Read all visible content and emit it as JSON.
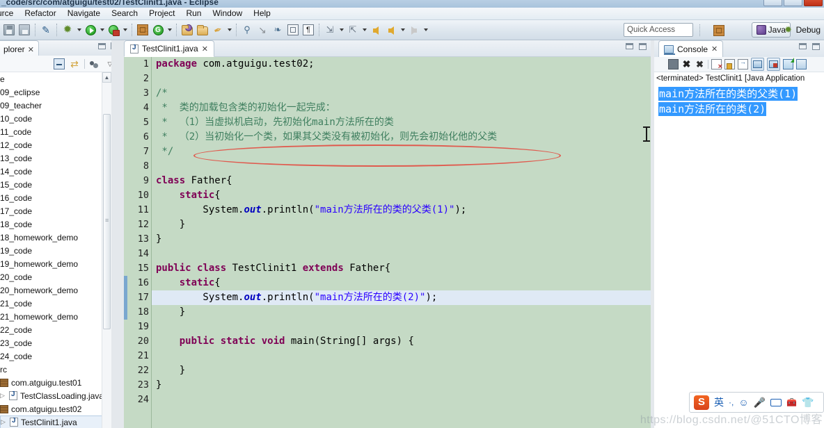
{
  "window": {
    "title": "_code/src/com/atguigu/test02/TestClinit1.java - Eclipse",
    "minimize_label": "",
    "maximize_label": "",
    "close_label": ""
  },
  "menubar": {
    "items": [
      {
        "label": "urce"
      },
      {
        "label": "Refactor"
      },
      {
        "label": "Navigate"
      },
      {
        "label": "Search"
      },
      {
        "label": "Project"
      },
      {
        "label": "Run"
      },
      {
        "label": "Window"
      },
      {
        "label": "Help"
      }
    ]
  },
  "toolbar": {
    "quick_access_placeholder": "Quick Access",
    "perspective_java": "Java",
    "perspective_debug": "Debug",
    "buttons": [
      {
        "name": "save-icon"
      },
      {
        "name": "save-all-icon"
      },
      {
        "name": "link-icon"
      },
      {
        "name": "external-tools-icon"
      },
      {
        "name": "run-icon"
      },
      {
        "name": "debug-icon"
      },
      {
        "name": "new-java-package-icon"
      },
      {
        "name": "open-type-icon"
      },
      {
        "name": "open-resource-icon"
      },
      {
        "name": "open-task-icon"
      },
      {
        "name": "brush-icon"
      },
      {
        "name": "pin-icon"
      },
      {
        "name": "wand-icon"
      },
      {
        "name": "toggle-block-icon"
      },
      {
        "name": "pilcrow-icon"
      },
      {
        "name": "next-annotation-icon"
      },
      {
        "name": "previous-annotation-icon"
      },
      {
        "name": "back-icon"
      },
      {
        "name": "forward-icon"
      }
    ]
  },
  "package_explorer": {
    "tab_label": "plorer",
    "tab_close": "✕",
    "toolbar": {
      "collapse_all": "collapse-all-icon",
      "link_with_editor": "link-with-editor-icon",
      "view_menu": "view-menu-icon"
    },
    "items": [
      {
        "label": "e",
        "type": "folder",
        "indent": 0,
        "expander": ""
      },
      {
        "label": "09_eclipse",
        "type": "folder",
        "indent": 0,
        "expander": ""
      },
      {
        "label": "09_teacher",
        "type": "folder",
        "indent": 0,
        "expander": ""
      },
      {
        "label": "10_code",
        "type": "folder",
        "indent": 0,
        "expander": ""
      },
      {
        "label": "11_code",
        "type": "folder",
        "indent": 0,
        "expander": ""
      },
      {
        "label": "12_code",
        "type": "folder",
        "indent": 0,
        "expander": ""
      },
      {
        "label": "13_code",
        "type": "folder",
        "indent": 0,
        "expander": ""
      },
      {
        "label": "14_code",
        "type": "folder",
        "indent": 0,
        "expander": ""
      },
      {
        "label": "15_code",
        "type": "folder",
        "indent": 0,
        "expander": ""
      },
      {
        "label": "16_code",
        "type": "folder",
        "indent": 0,
        "expander": ""
      },
      {
        "label": "17_code",
        "type": "folder",
        "indent": 0,
        "expander": ""
      },
      {
        "label": "18_code",
        "type": "folder",
        "indent": 0,
        "expander": ""
      },
      {
        "label": "18_homework_demo",
        "type": "folder",
        "indent": 0,
        "expander": ""
      },
      {
        "label": "19_code",
        "type": "folder",
        "indent": 0,
        "expander": ""
      },
      {
        "label": "19_homework_demo",
        "type": "folder",
        "indent": 0,
        "expander": ""
      },
      {
        "label": "20_code",
        "type": "folder",
        "indent": 0,
        "expander": ""
      },
      {
        "label": "20_homework_demo",
        "type": "folder",
        "indent": 0,
        "expander": ""
      },
      {
        "label": "21_code",
        "type": "folder",
        "indent": 0,
        "expander": ""
      },
      {
        "label": "21_homework_demo",
        "type": "folder",
        "indent": 0,
        "expander": ""
      },
      {
        "label": "22_code",
        "type": "folder",
        "indent": 0,
        "expander": ""
      },
      {
        "label": "23_code",
        "type": "folder",
        "indent": 0,
        "expander": ""
      },
      {
        "label": "24_code",
        "type": "folder",
        "indent": 0,
        "expander": ""
      },
      {
        "label": "rc",
        "type": "source-folder",
        "indent": 0,
        "expander": ""
      },
      {
        "label": "com.atguigu.test01",
        "type": "package",
        "indent": 0,
        "expander": ""
      },
      {
        "label": "TestClassLoading.java",
        "type": "java-file",
        "indent": 1,
        "expander": "▷"
      },
      {
        "label": "com.atguigu.test02",
        "type": "package",
        "indent": 0,
        "expander": ""
      },
      {
        "label": "TestClinit1.java",
        "type": "java-file",
        "indent": 1,
        "expander": "▷",
        "selected": true
      }
    ]
  },
  "editor": {
    "tab_label": "TestClinit1.java",
    "tab_close": "✕",
    "lines": [
      {
        "n": "1",
        "fold": "",
        "html": "<span class=\"k\">package</span> com.atguigu.test02;"
      },
      {
        "n": "2",
        "fold": "",
        "html": ""
      },
      {
        "n": "3",
        "fold": "⊖",
        "html": "<span class=\"cmt\">/*</span>"
      },
      {
        "n": "4",
        "fold": "",
        "html": "<span class=\"cmt\"> *  类的加载包含类的初始化一起完成：</span>"
      },
      {
        "n": "5",
        "fold": "",
        "html": "<span class=\"cmt\"> *  （1）当虚拟机启动，先初始化main方法所在的类</span>"
      },
      {
        "n": "6",
        "fold": "",
        "html": "<span class=\"cmt\"> *  （2）当初始化一个类，如果其父类没有被初始化，则先会初始化他的父类</span>"
      },
      {
        "n": "7",
        "fold": "",
        "html": "<span class=\"cmt\"> */</span>"
      },
      {
        "n": "8",
        "fold": "",
        "html": ""
      },
      {
        "n": "9",
        "fold": "",
        "html": "<span class=\"k\">class</span> Father{"
      },
      {
        "n": "10",
        "fold": "⊖",
        "html": "    <span class=\"k\">static</span>{"
      },
      {
        "n": "11",
        "fold": "",
        "html": "        System.<span class=\"fld\">out</span>.println(<span class=\"str\">\"main方法所在的类的父类(1)\"</span>);"
      },
      {
        "n": "12",
        "fold": "",
        "html": "    }"
      },
      {
        "n": "13",
        "fold": "",
        "html": "}"
      },
      {
        "n": "14",
        "fold": "",
        "html": ""
      },
      {
        "n": "15",
        "fold": "",
        "html": "<span class=\"k\">public</span> <span class=\"k\">class</span> TestClinit1 <span class=\"k\">extends</span> Father{"
      },
      {
        "n": "16",
        "fold": "⊖",
        "html": "    <span class=\"k\">static</span>{"
      },
      {
        "n": "17",
        "fold": "",
        "html": "        System.<span class=\"fld\">out</span>.println(<span class=\"str\">\"main方法所在的类(2)\"</span>);",
        "highlight": true
      },
      {
        "n": "18",
        "fold": "",
        "html": "    }"
      },
      {
        "n": "19",
        "fold": "",
        "html": ""
      },
      {
        "n": "20",
        "fold": "⊖",
        "html": "    <span class=\"k\">public</span> <span class=\"k\">static</span> <span class=\"k\">void</span> main(String[] args) {"
      },
      {
        "n": "21",
        "fold": "",
        "html": ""
      },
      {
        "n": "22",
        "fold": "",
        "html": "    }"
      },
      {
        "n": "23",
        "fold": "",
        "html": "}"
      },
      {
        "n": "24",
        "fold": "",
        "html": ""
      }
    ]
  },
  "console": {
    "tab_label": "Console",
    "tab_close": "✕",
    "process_label": "<terminated> TestClinit1 [Java Application",
    "output": [
      {
        "text": "main方法所在的类的父类(1)"
      },
      {
        "text": "main方法所在的类(2)"
      }
    ],
    "toolbar_buttons": [
      {
        "name": "terminate-icon"
      },
      {
        "name": "remove-launch-icon"
      },
      {
        "name": "remove-all-terminated-icon"
      },
      {
        "name": "clear-console-icon"
      },
      {
        "name": "scroll-lock-icon"
      },
      {
        "name": "word-wrap-icon"
      },
      {
        "name": "show-console-on-output-icon"
      },
      {
        "name": "show-console-on-error-icon"
      },
      {
        "name": "pin-console-icon"
      },
      {
        "name": "display-selected-console-icon"
      }
    ]
  },
  "ime": {
    "logo": "S",
    "mode_label": "英",
    "punctuation_label": "·,",
    "emoji_label": "☺",
    "mic_label": "🎤",
    "keyboard_label": "keyboard-icon",
    "toolbox_label": "toolbox-icon",
    "skin_label": "👕"
  },
  "watermark": {
    "text": "https://blog.csdn.net/@51CTO博客"
  },
  "colors": {
    "editor_background": "#c5dac5",
    "keyword": "#7f0055",
    "string": "#2a00ff",
    "comment": "#3f7f5f",
    "field": "#0000c0",
    "selection": "#3399ff",
    "annotation_ellipse": "#e05a4e",
    "change_bar": "#7aa7cf"
  }
}
